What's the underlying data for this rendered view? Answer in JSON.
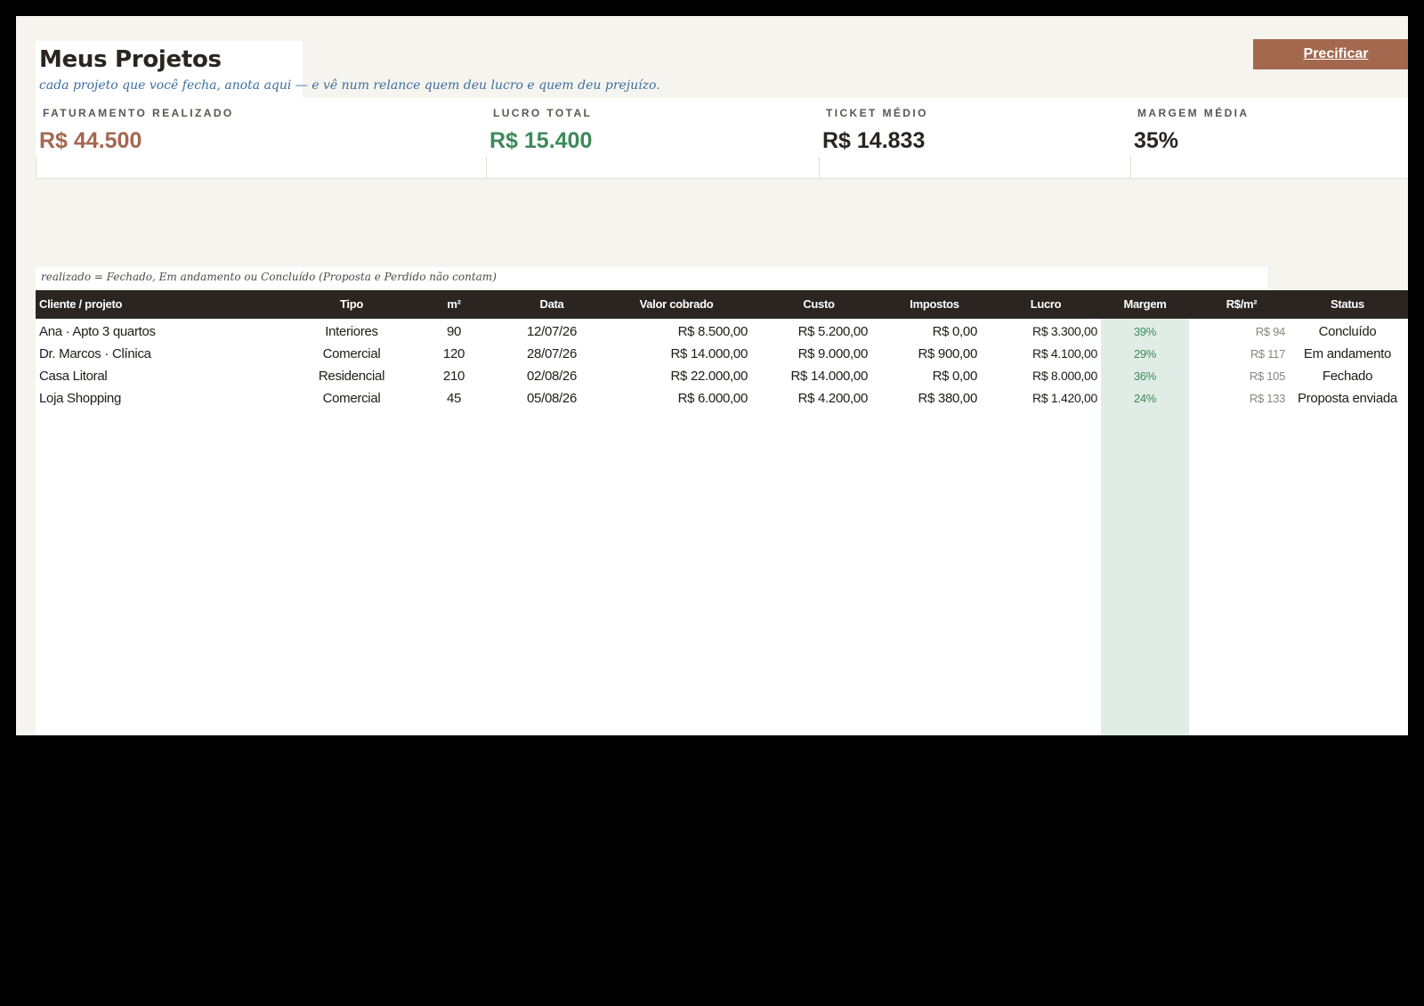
{
  "header": {
    "title": "Meus Projetos",
    "subtitle": "cada projeto que você fecha, anota aqui — e vê num relance quem deu lucro e quem deu prejuízo.",
    "precificar_label": "Precificar"
  },
  "kpis": [
    {
      "label": "FATURAMENTO REALIZADO",
      "value": "R$ 44.500",
      "color": "#a4684f"
    },
    {
      "label": "LUCRO TOTAL",
      "value": "R$ 15.400",
      "color": "#3e8a59"
    },
    {
      "label": "TICKET MÉDIO",
      "value": "R$ 14.833",
      "color": "#2b2520"
    },
    {
      "label": "MARGEM MÉDIA",
      "value": "35%",
      "color": "#2b2520"
    }
  ],
  "note": "realizado = Fechado, Em andamento ou Concluído (Proposta e Perdido não contam)",
  "table": {
    "columns": [
      "Cliente / projeto",
      "Tipo",
      "m²",
      "Data",
      "Valor cobrado",
      "Custo",
      "Impostos",
      "Lucro",
      "Margem",
      "R$/m²",
      "Status"
    ],
    "rows": [
      [
        "Ana · Apto 3 quartos",
        "Interiores",
        "90",
        "12/07/26",
        "R$ 8.500,00",
        "R$ 5.200,00",
        "R$ 0,00",
        "R$ 3.300,00",
        "39%",
        "R$ 94",
        "Concluído"
      ],
      [
        "Dr. Marcos · Clínica",
        "Comercial",
        "120",
        "28/07/26",
        "R$ 14.000,00",
        "R$ 9.000,00",
        "R$ 900,00",
        "R$ 4.100,00",
        "29%",
        "R$ 117",
        "Em andamento"
      ],
      [
        "Casa Litoral",
        "Residencial",
        "210",
        "02/08/26",
        "R$ 22.000,00",
        "R$ 14.000,00",
        "R$ 0,00",
        "R$ 8.000,00",
        "36%",
        "R$ 105",
        "Fechado"
      ],
      [
        "Loja Shopping",
        "Comercial",
        "45",
        "05/08/26",
        "R$ 6.000,00",
        "R$ 4.200,00",
        "R$ 380,00",
        "R$ 1.420,00",
        "24%",
        "R$ 133",
        "Proposta enviada"
      ]
    ]
  },
  "colors": {
    "accent": "#a4684f",
    "positive": "#3e8a59",
    "header_dark": "#2b2521",
    "margin_band": "#dfede6",
    "subtitle_blue": "#3d6fa0"
  }
}
